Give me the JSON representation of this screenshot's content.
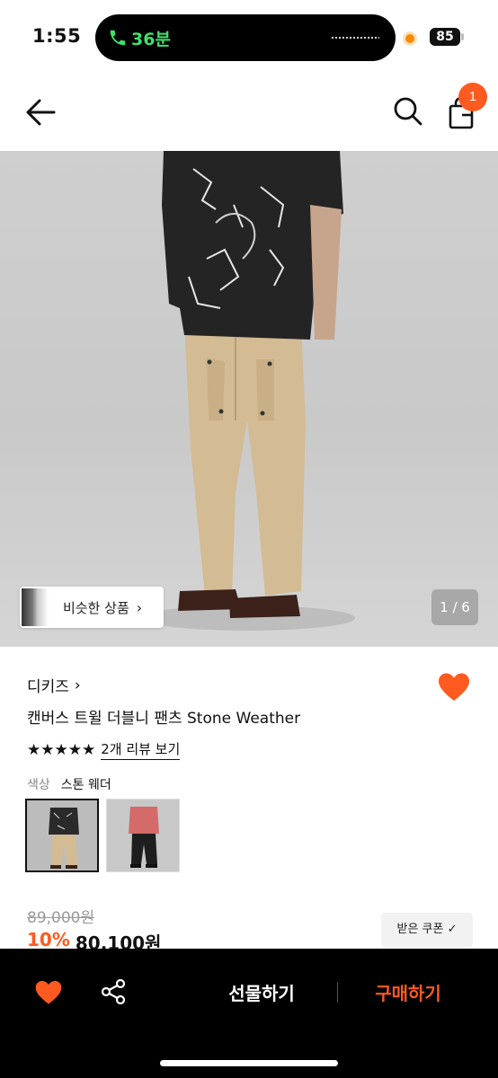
{
  "status_bar": {
    "time": "1:55",
    "call_duration": "36분",
    "battery": "85"
  },
  "nav": {
    "cart_count": "1"
  },
  "gallery": {
    "similar_label": "비슷한 상품",
    "page_counter": "1 / 6"
  },
  "product": {
    "brand": "디키즈",
    "name": "캔버스 트윌 더블니 팬츠 Stone Weather",
    "rating_stars": "★★★★★",
    "review_link": "2개 리뷰 보기",
    "color_label": "색상",
    "color_value": "스톤 웨더",
    "original_price": "89,000원",
    "discount": "10%",
    "price": "80,100원",
    "coupon_label": "받은 쿠폰 ✓"
  },
  "bottom_bar": {
    "gift_label": "선물하기",
    "buy_label": "구매하기"
  },
  "colors": {
    "accent": "#ff5a1f",
    "heart": "#ff5a1f"
  }
}
